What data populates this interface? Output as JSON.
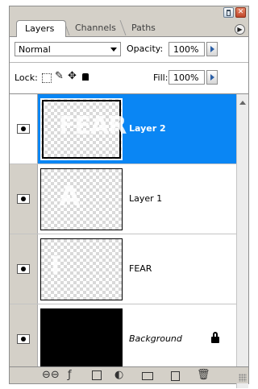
{
  "tabs": [
    "Layers",
    "Channels",
    "Paths"
  ],
  "blend_mode": "Normal",
  "opacity": {
    "label": "Opacity:",
    "value": "100%"
  },
  "lock": {
    "label": "Lock:"
  },
  "fill": {
    "label": "Fill:",
    "value": "100%"
  },
  "layers": [
    {
      "name": "Layer 2",
      "selected": true,
      "visible": true,
      "thumb_text": "FEAR"
    },
    {
      "name": "Layer 1",
      "selected": false,
      "visible": true,
      "thumb_text": "A"
    },
    {
      "name": "FEAR",
      "selected": false,
      "visible": true,
      "thumb_text": "I"
    },
    {
      "name": "Background",
      "selected": false,
      "visible": true,
      "locked": true
    }
  ],
  "colors": {
    "selection": "#0a86f4",
    "panel": "#d4d0c8"
  },
  "icons": [
    "link-layers-icon",
    "layer-style-icon",
    "layer-mask-icon",
    "adjustment-layer-icon",
    "new-group-icon",
    "new-layer-icon",
    "delete-layer-icon"
  ]
}
